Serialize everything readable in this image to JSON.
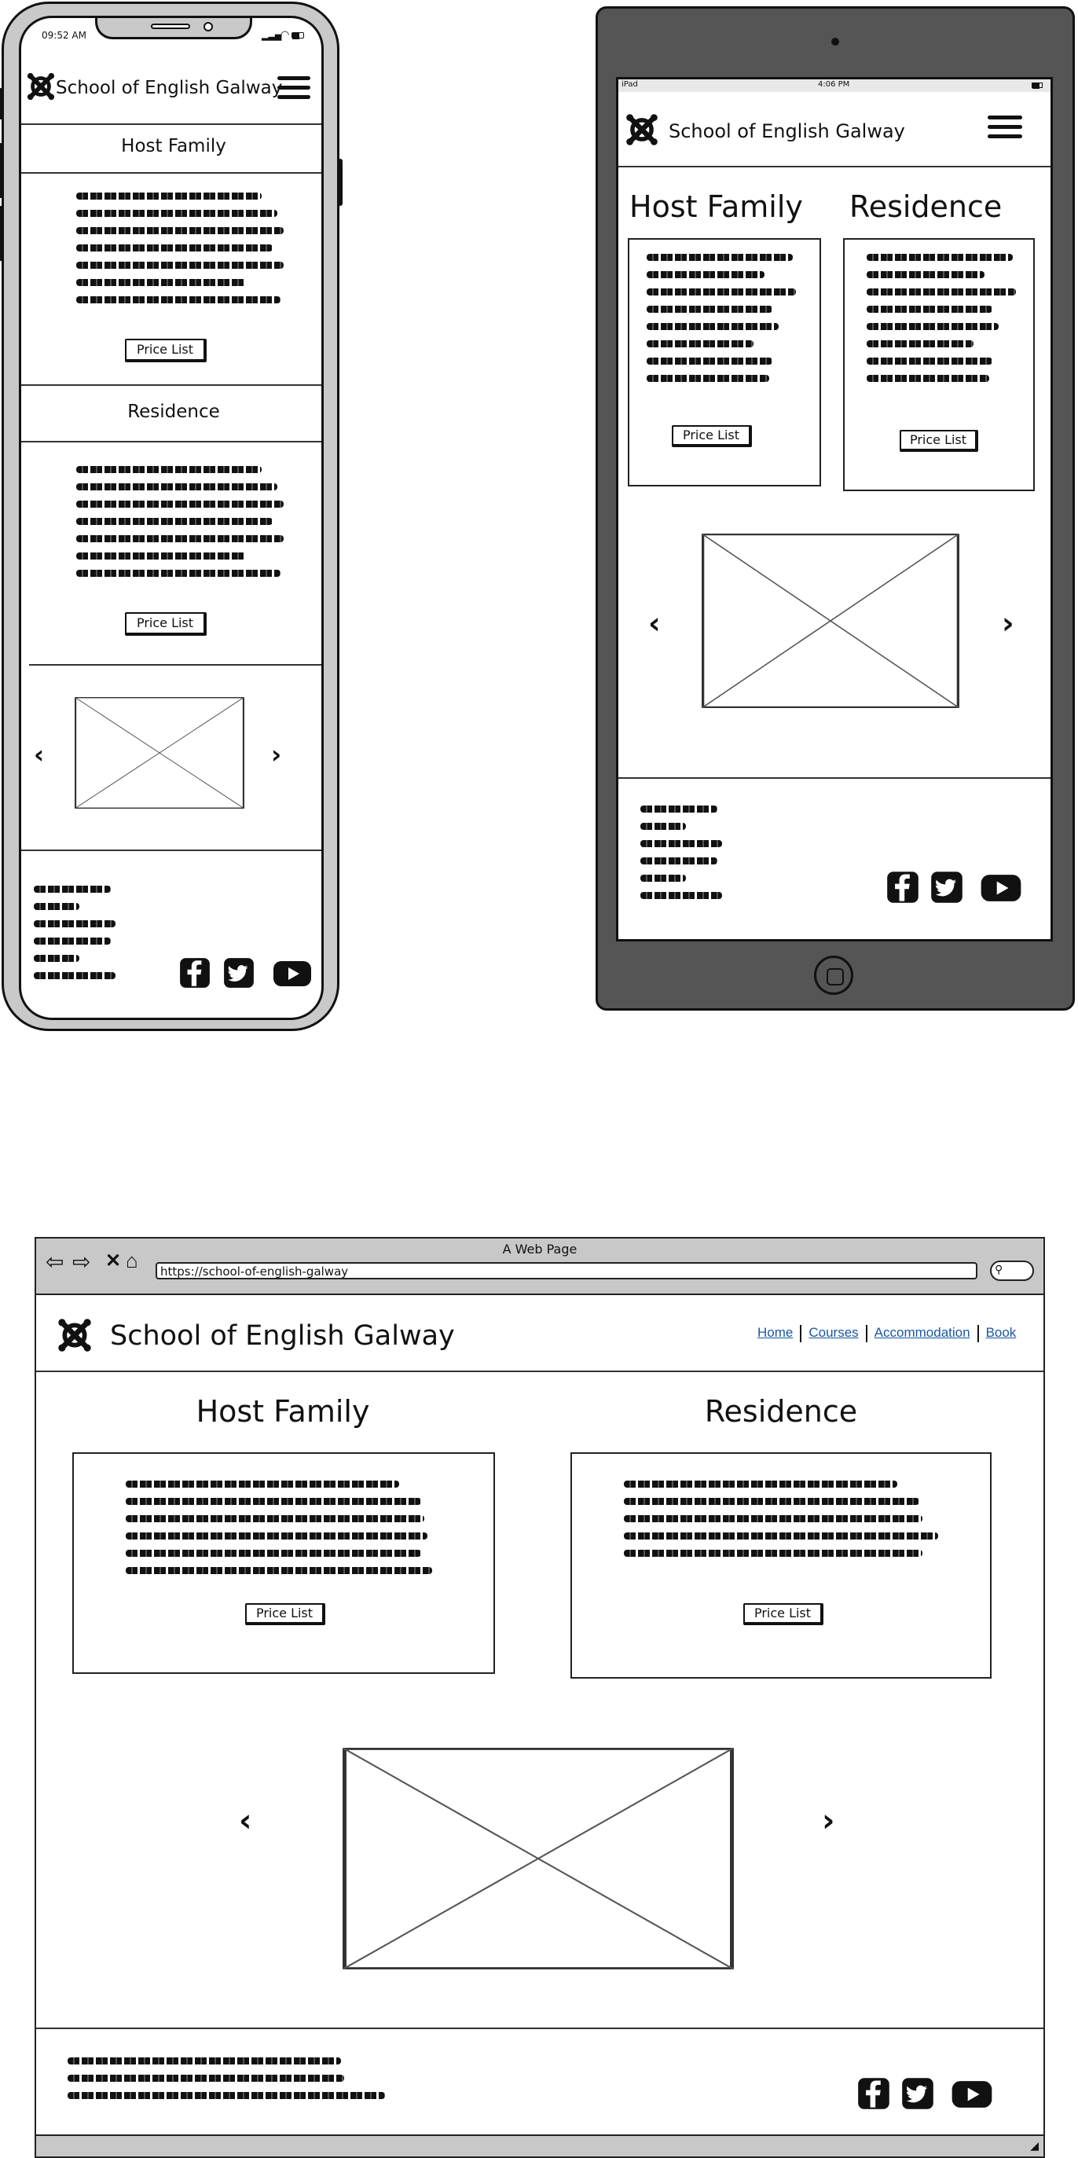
{
  "phone": {
    "status_time": "09:52 AM",
    "brand": "School of English Galway",
    "sections": [
      {
        "title": "Host Family",
        "button": "Price List"
      },
      {
        "title": "Residence",
        "button": "Price List"
      }
    ],
    "icons": [
      "logo-icon",
      "hamburger-menu-icon",
      "facebook-icon",
      "twitter-icon",
      "youtube-icon",
      "chevron-left-icon",
      "chevron-right-icon"
    ]
  },
  "tablet": {
    "status_device": "iPad",
    "status_time": "4:06 PM",
    "brand": "School of English Galway",
    "sections": [
      {
        "title": "Host Family",
        "button": "Price List"
      },
      {
        "title": "Residence",
        "button": "Price List"
      }
    ]
  },
  "desktop": {
    "window_title": "A Web Page",
    "url": "https://school-of-english-galway",
    "brand": "School of English Galway",
    "nav": [
      "Home",
      "Courses",
      "Accommodation",
      "Book"
    ],
    "sections": [
      {
        "title": "Host Family",
        "button": "Price List"
      },
      {
        "title": "Residence",
        "button": "Price List"
      }
    ]
  },
  "colors": {
    "device_frame": "#555555",
    "phone_frame": "#c9c9c9",
    "link": "#1a57a4",
    "browser_chrome": "#c8c8c8"
  }
}
